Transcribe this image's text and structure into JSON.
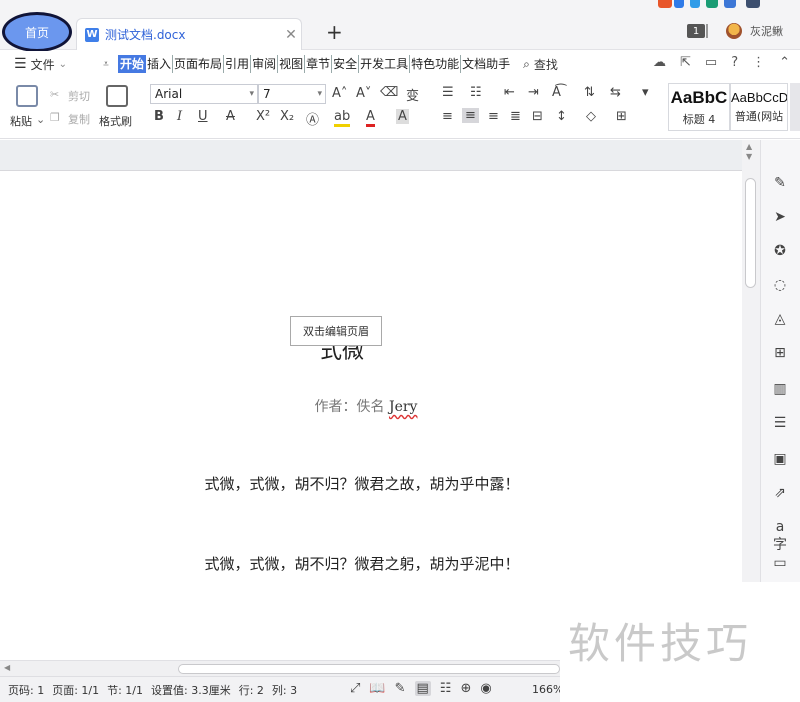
{
  "tabs": {
    "home": "首页",
    "document": "测试文档.docx",
    "window_count": "1",
    "user": "灰泥鳅"
  },
  "menu": {
    "file": "文件",
    "tabs": [
      "开始",
      "插入",
      "页面布局",
      "引用",
      "审阅",
      "视图",
      "章节",
      "安全",
      "开发工具",
      "特色功能",
      "文档助手"
    ],
    "find": "查找"
  },
  "toolbar": {
    "paste": "粘贴",
    "cut": "剪切",
    "copy": "复制",
    "format_painter": "格式刷",
    "font_name": "Arial",
    "font_size": "7",
    "styles": [
      "AaBbC",
      "AaBbCcD"
    ],
    "style_names": [
      "标题 4",
      "普通(网站"
    ]
  },
  "document": {
    "title": "式微",
    "header_tip": "双击编辑页眉",
    "author_label": "作者：佚名",
    "author_name": "Jery",
    "verses": [
      "式微，式微，胡不归？微君之故，胡为乎中露！",
      "式微，式微，胡不归？微君之躬，胡为乎泥中！"
    ]
  },
  "status": {
    "page_no": "页码: 1",
    "pages": "页面: 1/1",
    "section": "节: 1/1",
    "setting": "设置值: 3.3厘米",
    "row": "行: 2",
    "col": "列: 3",
    "zoom": "166%"
  },
  "watermark": "软件技巧"
}
